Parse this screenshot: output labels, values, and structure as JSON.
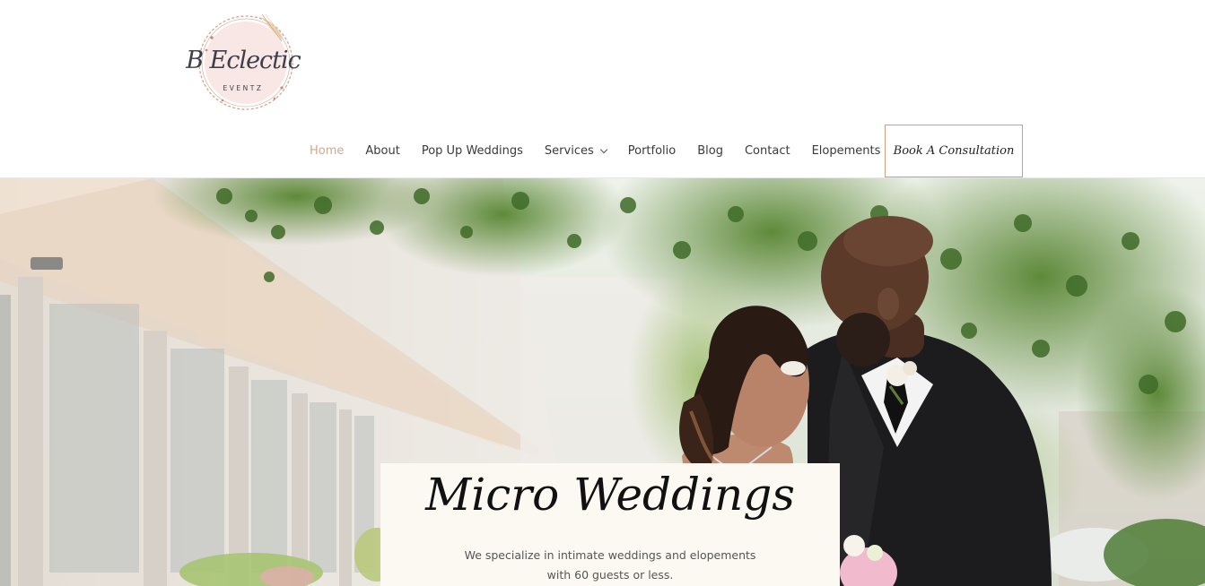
{
  "brand": {
    "logo_script": "B Eclectic",
    "logo_sub": "EVENTZ",
    "accent": "#d1a98b",
    "cta_border": "#c9a17c"
  },
  "nav": {
    "items": [
      {
        "label": "Home",
        "active": true
      },
      {
        "label": "About"
      },
      {
        "label": "Pop Up Weddings"
      },
      {
        "label": "Services",
        "has_dropdown": true
      },
      {
        "label": "Portfolio"
      },
      {
        "label": "Blog"
      },
      {
        "label": "Contact"
      },
      {
        "label": "Elopements"
      }
    ],
    "cta_label": "Book A Consultation"
  },
  "hero": {
    "title": "Micro Weddings",
    "text_line1": "We specialize in intimate weddings and elopements",
    "text_line2": "with 60 guests or less."
  }
}
